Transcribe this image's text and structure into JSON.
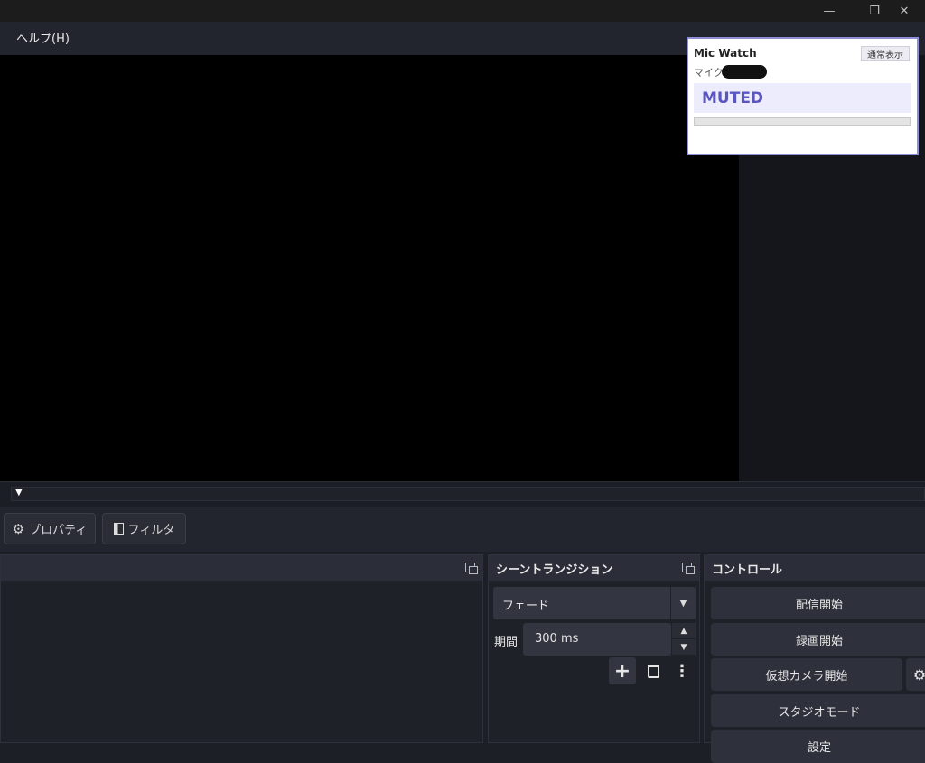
{
  "window": {
    "minimize": "—",
    "restore": "❐",
    "close": "✕"
  },
  "menu": {
    "help": "ヘルプ(H)"
  },
  "toolbar": {
    "properties": "プロパティ",
    "filters": "フィルタ"
  },
  "transition": {
    "title": "シーントランジション",
    "selected": "フェード",
    "duration_label": "期間",
    "duration_value": "300 ms"
  },
  "controls": {
    "title": "コントロール",
    "buttons": [
      "配信開始",
      "録画開始",
      "仮想カメラ開始",
      "スタジオモード",
      "設定"
    ]
  },
  "mic_widget": {
    "title": "Mic Watch",
    "mode_button": "通常表示",
    "mic_label": "マイク",
    "status": "MUTED",
    "level": 0,
    "accent": "#5a55c0"
  },
  "icons": {
    "gear": "gear-icon",
    "filter": "filter-icon",
    "add": "plus-icon",
    "delete": "trash-icon",
    "more": "more-vertical-icon"
  }
}
